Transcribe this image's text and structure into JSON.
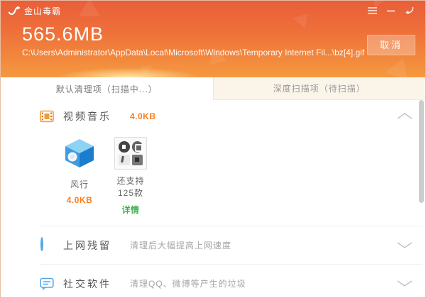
{
  "window": {
    "title": "金山毒霸",
    "controls": {
      "menu_icon": "hamburger-menu",
      "minimize_icon": "minimize-dash",
      "back_icon": "return-arrow"
    }
  },
  "header": {
    "scanned_size": "565.6MB",
    "scanning_path": "C:\\Users\\Administrator\\AppData\\Local\\Microsoft\\Windows\\Temporary Internet Fil...\\bz[4].gif",
    "cancel_label": "取消"
  },
  "tabs": [
    {
      "label": "默认清理项（扫描中...）",
      "active": true
    },
    {
      "label": "深度扫描项（待扫描）",
      "active": false
    }
  ],
  "sections": [
    {
      "id": "video-music",
      "icon": "film-icon",
      "title": "视频音乐",
      "value": "4.0KB",
      "expanded": true,
      "items": [
        {
          "icon": "funshion-cube-icon",
          "label": "风行",
          "value": "4.0KB",
          "value_color": "#f87e22"
        },
        {
          "icon": "more-apps-grid-icon",
          "label": "还支持125款",
          "value": "详情",
          "value_color": "#3fb24f"
        }
      ]
    },
    {
      "id": "web-residue",
      "icon": "loading-circle-icon",
      "title": "上网残留",
      "desc": "清理后大幅提高上网速度",
      "expanded": false
    },
    {
      "id": "social-software",
      "icon": "chat-bubble-icon",
      "title": "社交软件",
      "desc": "清理QQ、微博等产生的垃圾",
      "expanded": false
    }
  ],
  "colors": {
    "header_top": "#e95e39",
    "header_bottom": "#f5993f",
    "accent_orange": "#f87e22",
    "accent_green": "#3fb24f",
    "accent_blue": "#54a8e8",
    "inactive_tab_bg": "#fbf5e9"
  }
}
